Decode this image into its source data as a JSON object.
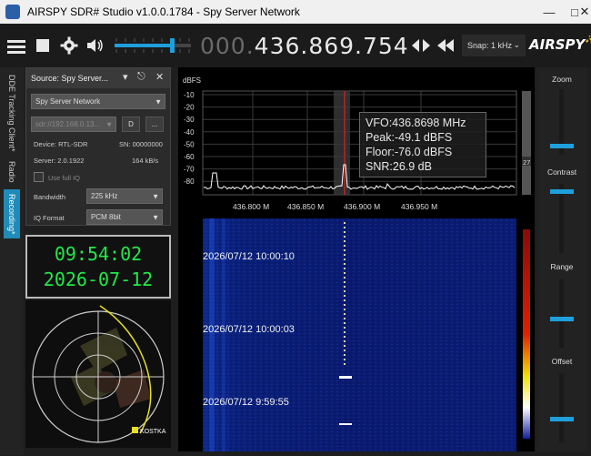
{
  "window": {
    "title": "AIRSPY SDR# Studio v1.0.0.1784 - Spy Server Network"
  },
  "toolbar": {
    "frequency_prefix": "000.",
    "frequency_main": "436.869.754",
    "snap_label": "Snap: 1 kHz",
    "logo": "AIRSPY",
    "volume_level": 0.75
  },
  "side_tabs": [
    {
      "label": "DDE Tracking Client*"
    },
    {
      "label": "Radio"
    },
    {
      "label": "Recording*"
    }
  ],
  "source_panel": {
    "title": "Source: Spy Server...",
    "source_type": "Spy Server Network",
    "uri_placeholder": "sdr://192.168.0.13...",
    "disconnect_label": "D",
    "more_label": "...",
    "device_label": "Device: RTL-SDR",
    "sn_label": "SN: 00000000",
    "server_label": "Server: 2.0.1922",
    "rate_label": "164 kB/s",
    "full_iq_label": "Use full IQ",
    "bandwidth_label": "Bandwidth",
    "bandwidth_value": "225 kHz",
    "iq_format_label": "IQ Format",
    "iq_format_value": "PCM 8bit"
  },
  "clock": {
    "time": "09:54:02",
    "date": "2026-07-12"
  },
  "radar": {
    "satellite_label": "KOSTKA"
  },
  "spectrum": {
    "dbfs_label": "dBFS",
    "y_ticks": [
      "-10",
      "-20",
      "-30",
      "-40",
      "-50",
      "-60",
      "-70",
      "-80"
    ],
    "x_ticks": [
      "436.800 M",
      "436.850 M",
      "436.900 M",
      "436.950 M"
    ],
    "scale_value": "27"
  },
  "vfo_info": {
    "vfo": "VFO:436.8698 MHz",
    "peak": "Peak:-49.1 dBFS",
    "floor": "Floor:-76.0 dBFS",
    "snr": "SNR:26.9 dB"
  },
  "waterfall": {
    "timestamps": [
      "2026/07/12 10:00:10",
      "2026/07/12 10:00:03",
      "2026/07/12 9:59:55"
    ]
  },
  "right_panel": {
    "zoom_label": "Zoom",
    "contrast_label": "Contrast",
    "range_label": "Range",
    "offset_label": "Offset"
  },
  "colors": {
    "accent": "#1ea0dc",
    "clock_digits": "#22e84a",
    "waterfall_bg": "#0a1a6e",
    "signal_trace": "#ffffff"
  }
}
